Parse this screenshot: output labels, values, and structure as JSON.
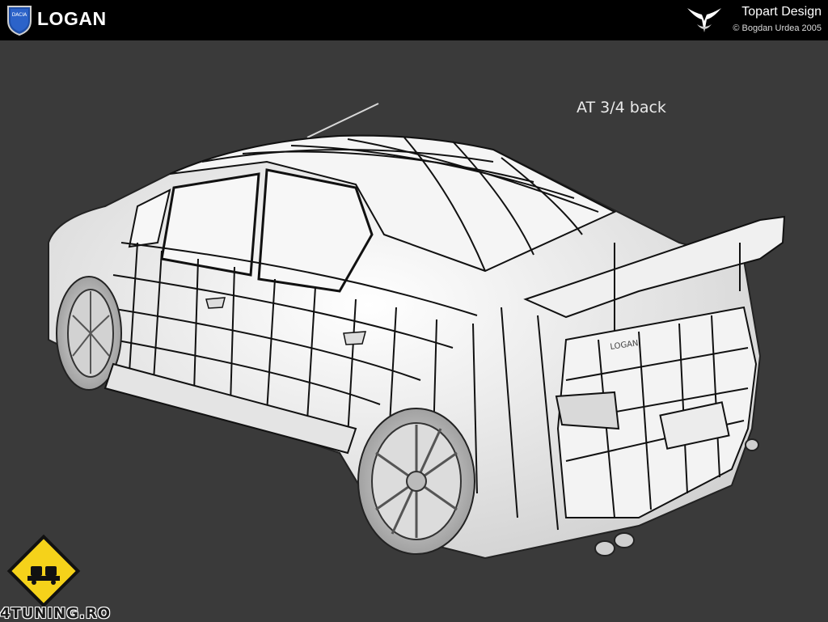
{
  "header": {
    "brand_name": "LOGAN",
    "brand_logo_text": "DACIA",
    "studio_name": "Topart Design",
    "studio_credit": "© Bogdan Urdea 2005"
  },
  "render": {
    "view_label": "AT 3/4 back",
    "subject": "wireframe-car-rear-three-quarter",
    "trunk_badge": "LOGAN"
  },
  "footer": {
    "site_name": "4TUNING.RO"
  },
  "colors": {
    "background": "#3a3a3a",
    "header_bar": "#000000",
    "wire_surface": "#f2f2f2",
    "wire_lines": "#111111",
    "badge_yellow": "#f5d21a"
  }
}
